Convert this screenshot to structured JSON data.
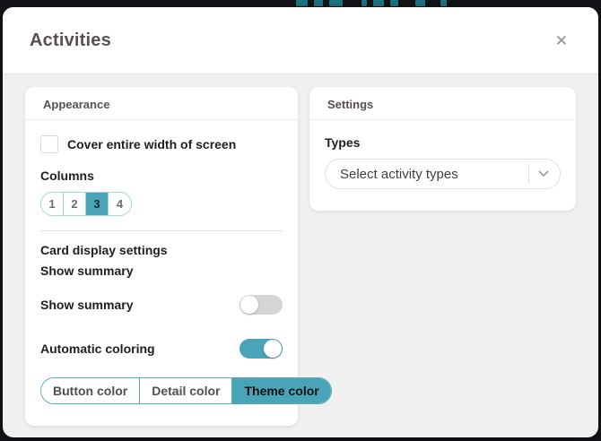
{
  "modal": {
    "title": "Activities",
    "close_icon": "✕"
  },
  "appearance": {
    "title": "Appearance",
    "cover_checkbox_label": "Cover entire width of screen",
    "cover_checkbox_checked": false,
    "columns_label": "Columns",
    "columns_options": [
      "1",
      "2",
      "3",
      "4"
    ],
    "columns_selected": "3",
    "card_display_title": "Card display settings",
    "card_display_subtitle": "Show summary",
    "show_summary_label": "Show summary",
    "show_summary_on": false,
    "automatic_coloring_label": "Automatic coloring",
    "automatic_coloring_on": true,
    "color_options": [
      "Button color",
      "Detail color",
      "Theme color"
    ],
    "color_selected": "Theme color"
  },
  "settings": {
    "title": "Settings",
    "types_label": "Types",
    "types_placeholder": "Select activity types"
  },
  "colors": {
    "accent": "#4aa4b7",
    "accent_border_light": "#9fd2dc",
    "accent_border_strong": "#58a9bb",
    "header_text": "#575052",
    "body_text": "#1f1f1f",
    "modal_body_bg": "#f1f0f1",
    "page_bg": "#14141a",
    "background_glyph": "#1d7e8c",
    "toggle_off": "#d6d6d6"
  }
}
